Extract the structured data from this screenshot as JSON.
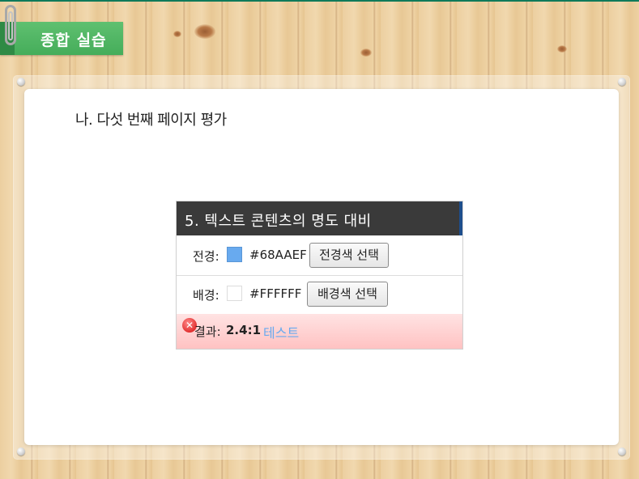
{
  "slide": {
    "section_title": "종합 실습",
    "subtitle": "나. 다섯 번째 페이지 평가"
  },
  "panel": {
    "title": "5. 텍스트 콘텐츠의 명도 대비",
    "foreground": {
      "label": "전경:",
      "color": "#68AAEF",
      "hex_text": "#68AAEF",
      "button_label": "전경색 선택"
    },
    "background": {
      "label": "배경:",
      "color": "#FFFFFF",
      "hex_text": "#FFFFFF",
      "button_label": "배경색 선택"
    },
    "result": {
      "label": "결과:",
      "ratio": "2.4:1",
      "sample_text": "테스트",
      "status_icon": "fail-x-icon",
      "status_color": "#E23030"
    }
  },
  "colors": {
    "accent_green": "#45AD5A",
    "header_dark": "#3A3A3A",
    "result_bg": "#FFC2C2"
  }
}
